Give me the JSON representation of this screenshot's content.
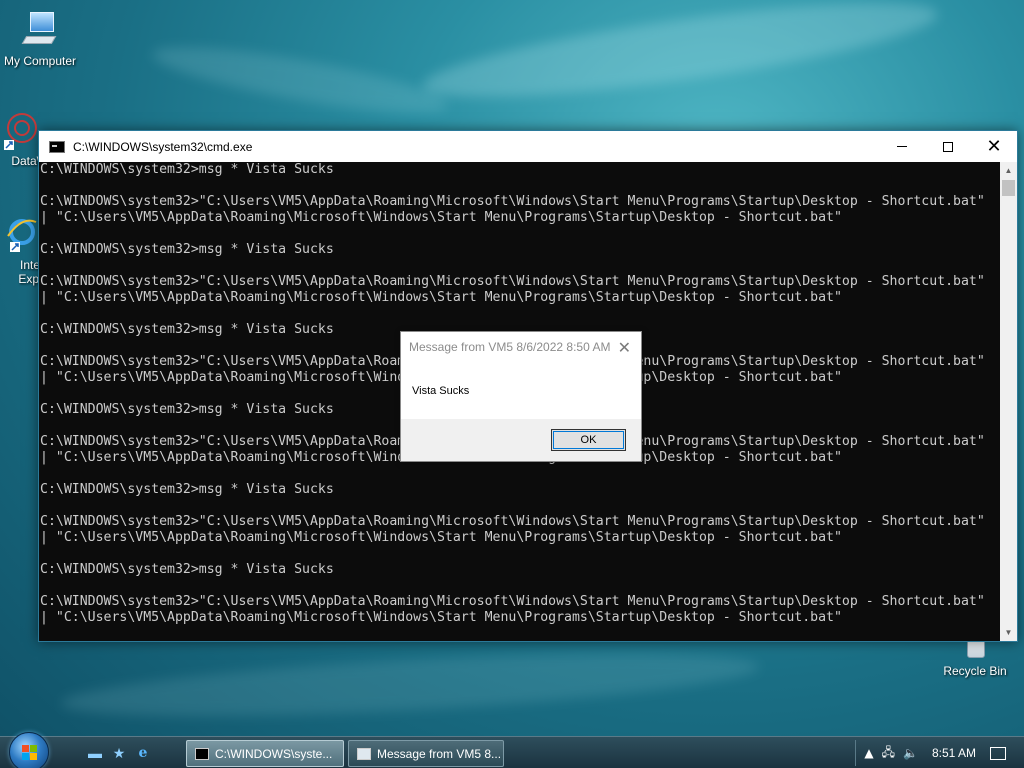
{
  "desktop": {
    "icons": [
      {
        "label": "My Computer"
      },
      {
        "label": "DataW"
      },
      {
        "label": "Inte Expl"
      },
      {
        "label": "Recycle Bin"
      }
    ]
  },
  "cmd_window": {
    "title": "C:\\WINDOWS\\system32\\cmd.exe",
    "lines": [
      "C:\\WINDOWS\\system32>msg * Vista Sucks",
      "",
      "C:\\WINDOWS\\system32>\"C:\\Users\\VM5\\AppData\\Roaming\\Microsoft\\Windows\\Start Menu\\Programs\\Startup\\Desktop - Shortcut.bat\"",
      "| \"C:\\Users\\VM5\\AppData\\Roaming\\Microsoft\\Windows\\Start Menu\\Programs\\Startup\\Desktop - Shortcut.bat\"",
      "",
      "C:\\WINDOWS\\system32>msg * Vista Sucks",
      "",
      "C:\\WINDOWS\\system32>\"C:\\Users\\VM5\\AppData\\Roaming\\Microsoft\\Windows\\Start Menu\\Programs\\Startup\\Desktop - Shortcut.bat\"",
      "| \"C:\\Users\\VM5\\AppData\\Roaming\\Microsoft\\Windows\\Start Menu\\Programs\\Startup\\Desktop - Shortcut.bat\"",
      "",
      "C:\\WINDOWS\\system32>msg * Vista Sucks",
      "",
      "C:\\WINDOWS\\system32>\"C:\\Users\\VM5\\AppData\\Roaming\\Microsoft\\Windows\\Start Menu\\Programs\\Startup\\Desktop - Shortcut.bat\"",
      "| \"C:\\Users\\VM5\\AppData\\Roaming\\Microsoft\\Windows\\Start Menu\\Programs\\Startup\\Desktop - Shortcut.bat\"",
      "",
      "C:\\WINDOWS\\system32>msg * Vista Sucks",
      "",
      "C:\\WINDOWS\\system32>\"C:\\Users\\VM5\\AppData\\Roaming\\Microsoft\\Windows\\Start Menu\\Programs\\Startup\\Desktop - Shortcut.bat\"",
      "| \"C:\\Users\\VM5\\AppData\\Roaming\\Microsoft\\Windows\\Start Menu\\Programs\\Startup\\Desktop - Shortcut.bat\"",
      "",
      "C:\\WINDOWS\\system32>msg * Vista Sucks",
      "",
      "C:\\WINDOWS\\system32>\"C:\\Users\\VM5\\AppData\\Roaming\\Microsoft\\Windows\\Start Menu\\Programs\\Startup\\Desktop - Shortcut.bat\"",
      "| \"C:\\Users\\VM5\\AppData\\Roaming\\Microsoft\\Windows\\Start Menu\\Programs\\Startup\\Desktop - Shortcut.bat\"",
      "",
      "C:\\WINDOWS\\system32>msg * Vista Sucks",
      "",
      "C:\\WINDOWS\\system32>\"C:\\Users\\VM5\\AppData\\Roaming\\Microsoft\\Windows\\Start Menu\\Programs\\Startup\\Desktop - Shortcut.bat\"",
      "| \"C:\\Users\\VM5\\AppData\\Roaming\\Microsoft\\Windows\\Start Menu\\Programs\\Startup\\Desktop - Shortcut.bat\""
    ]
  },
  "message_box": {
    "title": "Message from VM5 8/6/2022 8:50 AM",
    "text": "Vista Sucks",
    "ok_label": "OK"
  },
  "taskbar": {
    "buttons": [
      {
        "label": "C:\\WINDOWS\\syste...",
        "icon": "cmd-icon"
      },
      {
        "label": "Message from VM5 8...",
        "icon": "window-icon"
      }
    ],
    "clock": "8:51 AM"
  }
}
